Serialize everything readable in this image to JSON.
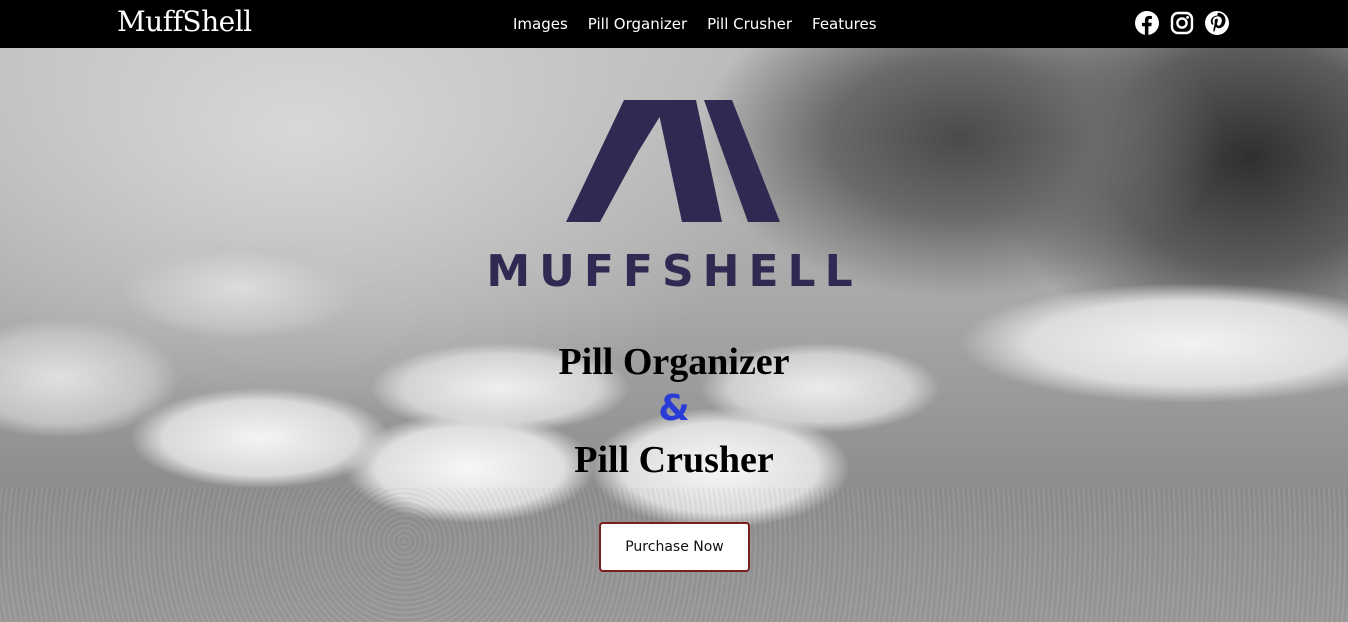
{
  "navbar": {
    "brand": "MuffShell",
    "links": [
      {
        "label": "Images"
      },
      {
        "label": "Pill Organizer"
      },
      {
        "label": "Pill Crusher"
      },
      {
        "label": "Features"
      }
    ],
    "social_icons": [
      "facebook-icon",
      "instagram-icon",
      "pinterest-icon"
    ]
  },
  "hero": {
    "logo_text": "MUFFSHELL",
    "headline_line1": "Pill Organizer",
    "ampersand": "&",
    "headline_line2": "Pill Crusher",
    "cta_label": "Purchase Now"
  },
  "colors": {
    "navbar_bg": "#000000",
    "logo": "#2e2a52",
    "ampersand": "#2b3bd8",
    "cta_border": "#7a1f1f"
  }
}
